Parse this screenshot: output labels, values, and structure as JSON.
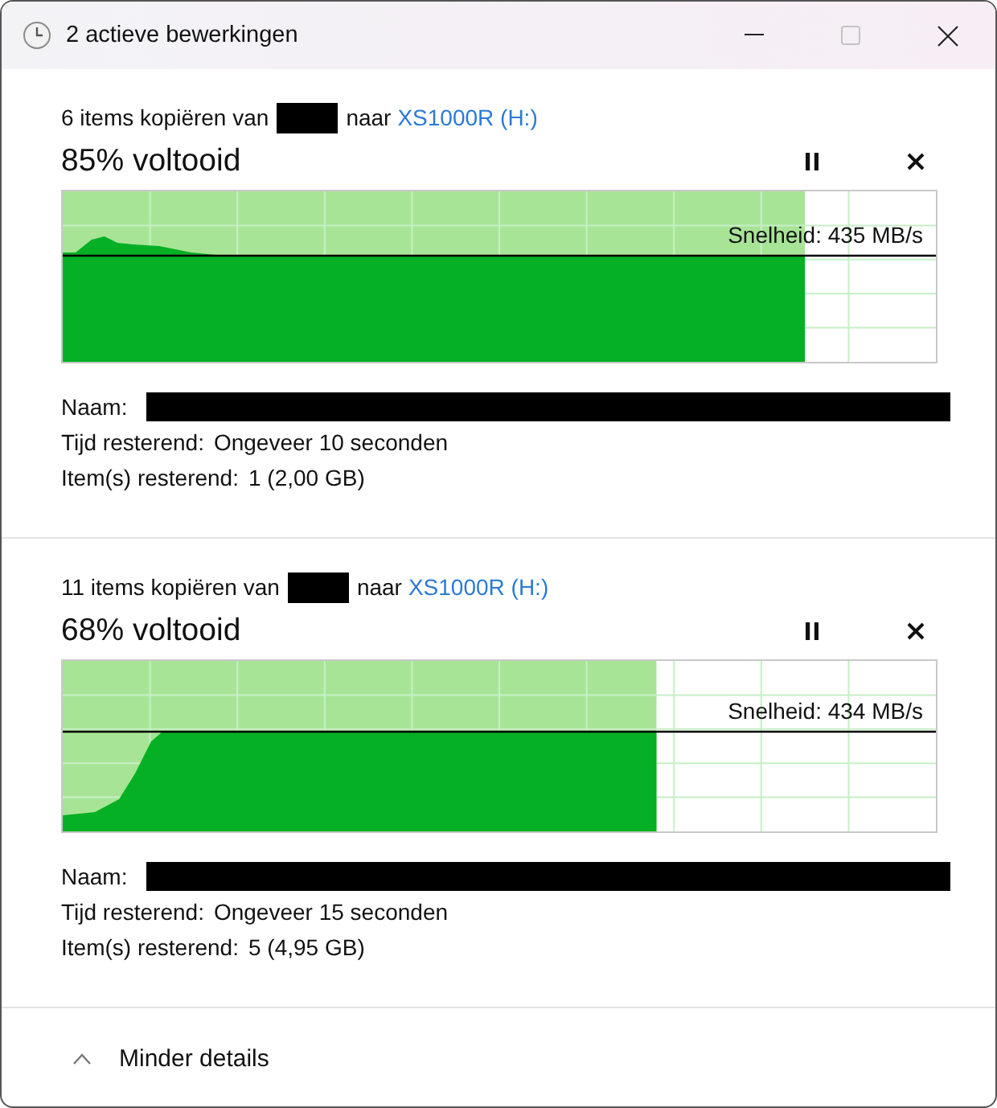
{
  "window": {
    "title": "2 actieve bewerkingen"
  },
  "operations": [
    {
      "prefix": "6 items kopiëren van",
      "middle": "naar",
      "destination": "XS1000R (H:)",
      "percent": "85% voltooid",
      "level": 0.85,
      "speed": "Snelheid: 435 MB/s",
      "details": [
        {
          "label": "Naam:",
          "redacted": true
        },
        {
          "label": "Tijd resterend:",
          "value": "Ongeveer 10 seconden"
        },
        {
          "label": "Item(s) resterend:",
          "value": "1 (2,00 GB)"
        }
      ]
    },
    {
      "prefix": "11 items kopiëren van",
      "middle": "naar",
      "destination": "XS1000R (H:)",
      "percent": "68% voltooid",
      "level": 0.68,
      "speed": "Snelheid: 434 MB/s",
      "details": [
        {
          "label": "Naam:",
          "redacted": true
        },
        {
          "label": "Tijd resterend:",
          "value": "Ongeveer 15 seconden"
        },
        {
          "label": "Item(s) resterend:",
          "value": "5 (4,95 GB)"
        }
      ]
    }
  ],
  "footer": {
    "toggle": "Minder details",
    "expanded": true
  }
}
